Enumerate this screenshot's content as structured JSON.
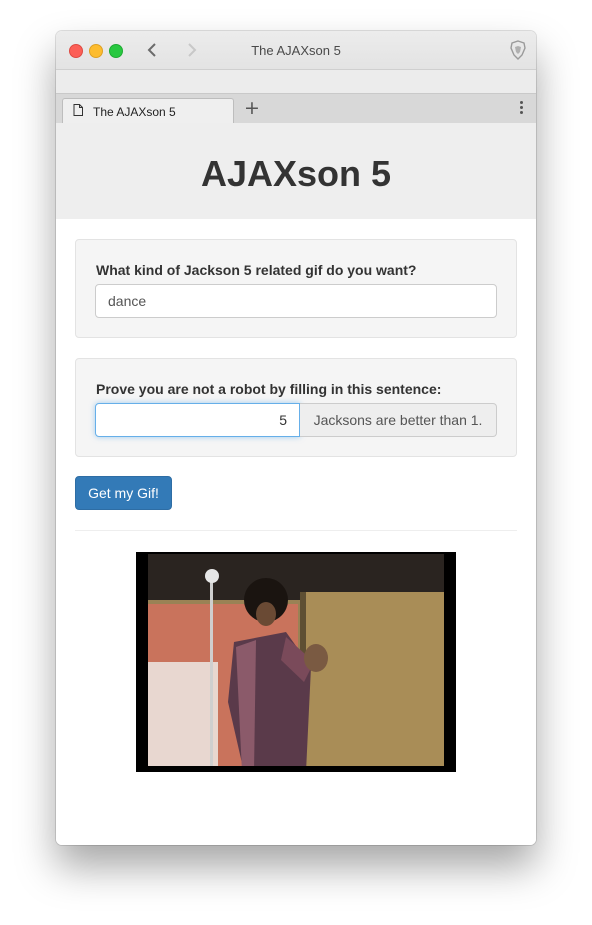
{
  "browser": {
    "window_title": "The AJAXson 5",
    "tab_label": "The AJAXson 5",
    "new_tab_symbol": "+"
  },
  "page": {
    "title": "AJAXson 5"
  },
  "gif_form": {
    "label": "What kind of Jackson 5 related gif do you want?",
    "value": "dance"
  },
  "captcha_form": {
    "label": "Prove you are not a robot by filling in this sentence:",
    "value": "5",
    "addon": "Jacksons are better than 1."
  },
  "submit": {
    "label": "Get my Gif!"
  },
  "icons": {
    "back": "chevron-left-icon",
    "forward": "chevron-right-icon",
    "brave": "brave-shield-icon",
    "tab": "document-icon",
    "menu": "kebab-menu-icon"
  },
  "colors": {
    "primary_button": "#337ab7",
    "header_bg": "#eeeeee",
    "focus_border": "#66afe9"
  }
}
